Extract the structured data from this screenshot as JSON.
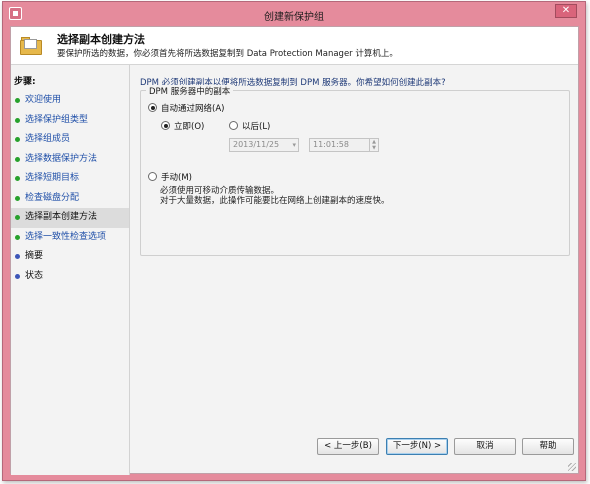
{
  "window": {
    "title": "创建新保护组",
    "close_glyph": "✕"
  },
  "header": {
    "title": "选择副本创建方法",
    "description": "要保护所选的数据，你必须首先将所选数据复制到 Data Protection Manager 计算机上。"
  },
  "steps": {
    "heading": "步骤:",
    "items": [
      {
        "label": "欢迎使用",
        "state": "done"
      },
      {
        "label": "选择保护组类型",
        "state": "done"
      },
      {
        "label": "选择组成员",
        "state": "done"
      },
      {
        "label": "选择数据保护方法",
        "state": "done"
      },
      {
        "label": "选择短期目标",
        "state": "done"
      },
      {
        "label": "检查磁盘分配",
        "state": "done"
      },
      {
        "label": "选择副本创建方法",
        "state": "current"
      },
      {
        "label": "选择一致性检查选项",
        "state": "done"
      },
      {
        "label": "摘要",
        "state": "pending"
      },
      {
        "label": "状态",
        "state": "pending"
      }
    ]
  },
  "main": {
    "question": "DPM 必须创建副本以便将所选数据复制到 DPM 服务器。你希望如何创建此副本?",
    "group_title": "DPM 服务器中的副本",
    "auto_label": "自动通过网络(A)",
    "now_label": "立即(O)",
    "later_label": "以后(L)",
    "date_value": "2013/11/25",
    "time_value": "11:01:58",
    "manual_label": "手动(M)",
    "manual_desc_line1": "必须使用可移动介质传输数据。",
    "manual_desc_line2": "对于大量数据，此操作可能要比在网络上创建副本的速度快。"
  },
  "buttons": {
    "back": "< 上一步(B)",
    "next": "下一步(N) >",
    "cancel": "取消",
    "help": "帮助"
  }
}
